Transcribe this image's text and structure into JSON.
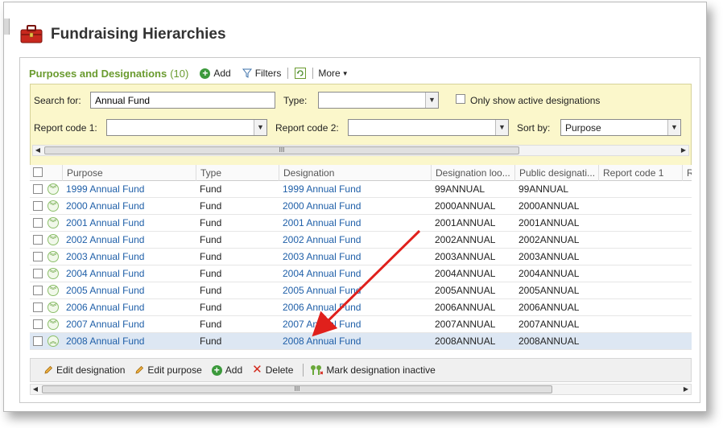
{
  "page": {
    "title": "Fundraising Hierarchies"
  },
  "panel": {
    "title": "Purposes and Designations",
    "count": "(10)",
    "toolbar": {
      "add_label": "Add",
      "filters_label": "Filters",
      "more_label": "More"
    }
  },
  "filters": {
    "search_label": "Search for:",
    "search_value": "Annual Fund",
    "type_label": "Type:",
    "type_value": "",
    "active_only_label": "Only show active designations",
    "report_code1_label": "Report code 1:",
    "report_code1_value": "",
    "report_code2_label": "Report code 2:",
    "report_code2_value": "",
    "sort_label": "Sort by:",
    "sort_value": "Purpose"
  },
  "grid": {
    "columns": [
      "Purpose",
      "Type",
      "Designation",
      "Designation loo...",
      "Public designati...",
      "Report code 1",
      "R"
    ],
    "rows": [
      {
        "purpose": "1999 Annual Fund",
        "type": "Fund",
        "designation": "1999 Annual Fund",
        "lookup": "99ANNUAL",
        "public": "99ANNUAL"
      },
      {
        "purpose": "2000 Annual Fund",
        "type": "Fund",
        "designation": "2000 Annual Fund",
        "lookup": "2000ANNUAL",
        "public": "2000ANNUAL"
      },
      {
        "purpose": "2001 Annual Fund",
        "type": "Fund",
        "designation": "2001 Annual Fund",
        "lookup": "2001ANNUAL",
        "public": "2001ANNUAL"
      },
      {
        "purpose": "2002 Annual Fund",
        "type": "Fund",
        "designation": "2002 Annual Fund",
        "lookup": "2002ANNUAL",
        "public": "2002ANNUAL"
      },
      {
        "purpose": "2003 Annual Fund",
        "type": "Fund",
        "designation": "2003 Annual Fund",
        "lookup": "2003ANNUAL",
        "public": "2003ANNUAL"
      },
      {
        "purpose": "2004 Annual Fund",
        "type": "Fund",
        "designation": "2004 Annual Fund",
        "lookup": "2004ANNUAL",
        "public": "2004ANNUAL"
      },
      {
        "purpose": "2005 Annual Fund",
        "type": "Fund",
        "designation": "2005 Annual Fund",
        "lookup": "2005ANNUAL",
        "public": "2005ANNUAL"
      },
      {
        "purpose": "2006 Annual Fund",
        "type": "Fund",
        "designation": "2006 Annual Fund",
        "lookup": "2006ANNUAL",
        "public": "2006ANNUAL"
      },
      {
        "purpose": "2007 Annual Fund",
        "type": "Fund",
        "designation": "2007 Annual Fund",
        "lookup": "2007ANNUAL",
        "public": "2007ANNUAL"
      },
      {
        "purpose": "2008 Annual Fund",
        "type": "Fund",
        "designation": "2008 Annual Fund",
        "lookup": "2008ANNUAL",
        "public": "2008ANNUAL"
      }
    ]
  },
  "actions": {
    "edit_designation": "Edit designation",
    "edit_purpose": "Edit purpose",
    "add": "Add",
    "delete": "Delete",
    "mark_inactive": "Mark designation inactive"
  },
  "scrollbar_grip": "III",
  "colors": {
    "accent_green": "#6a9b2f",
    "link_blue": "#1f5fa8",
    "filter_bg": "#fbf7cb",
    "selected_row": "#dde7f3",
    "annotation_arrow": "#e0201c"
  }
}
